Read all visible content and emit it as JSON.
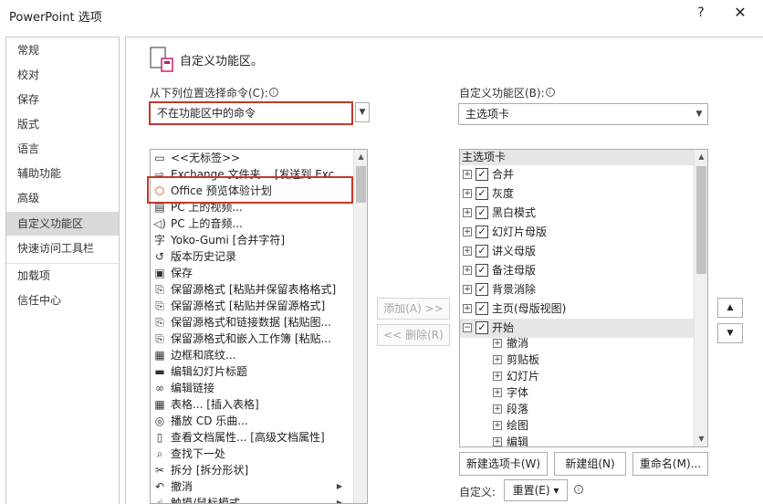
{
  "window": {
    "title": "PowerPoint 选项",
    "help_label": "?",
    "close_label": "✕"
  },
  "sidebar": {
    "items": [
      {
        "label": "常规"
      },
      {
        "label": "校对"
      },
      {
        "label": "保存"
      },
      {
        "label": "版式"
      },
      {
        "label": "语言"
      },
      {
        "label": "辅助功能"
      },
      {
        "label": "高级"
      },
      {
        "label": "自定义功能区",
        "active": true
      },
      {
        "label": "快速访问工具栏"
      },
      {
        "label": "加载项"
      },
      {
        "label": "信任中心"
      }
    ]
  },
  "section": {
    "title": "自定义功能区。"
  },
  "left": {
    "choose_label": "从下列位置选择命令(C):",
    "info": "i",
    "choose_value": "不在功能区中的命令",
    "arrow": "▼",
    "commands": [
      {
        "icon": "tag-icon",
        "glyph": "▭",
        "label": "<<无标签>>"
      },
      {
        "icon": "exchange-folder-icon",
        "glyph": "⇨",
        "label": "Exchange 文件夹... [发送到 Exc"
      },
      {
        "icon": "office-logo-icon",
        "glyph": "⬡",
        "label": "Office 预览体验计划"
      },
      {
        "icon": "video-icon",
        "glyph": "▤",
        "label": "PC 上的视频..."
      },
      {
        "icon": "audio-icon",
        "glyph": "◁)",
        "label": "PC 上的音频..."
      },
      {
        "icon": "yoko-gumi-icon",
        "glyph": "字",
        "label": "Yoko-Gumi [合并字符]"
      },
      {
        "icon": "history-icon",
        "glyph": "↺",
        "label": "版本历史记录"
      },
      {
        "icon": "save-icon",
        "glyph": "▣",
        "label": "保存"
      },
      {
        "icon": "paste-keep-source-icon",
        "glyph": "⎘",
        "label": "保留源格式 [粘贴并保留表格格式]"
      },
      {
        "icon": "paste-keep-source-icon",
        "glyph": "⎘",
        "label": "保留源格式 [粘贴并保留源格式]"
      },
      {
        "icon": "paste-link-icon",
        "glyph": "⎘",
        "label": "保留源格式和链接数据 [粘贴图..."
      },
      {
        "icon": "paste-embed-icon",
        "glyph": "⎘",
        "label": "保留源格式和嵌入工作簿 [粘贴..."
      },
      {
        "icon": "border-shading-icon",
        "glyph": "▦",
        "label": "边框和底纹..."
      },
      {
        "icon": "edit-slide-title-icon",
        "glyph": "▬",
        "label": "编辑幻灯片标题"
      },
      {
        "icon": "edit-link-icon",
        "glyph": "∞",
        "label": "编辑链接"
      },
      {
        "icon": "table-icon",
        "glyph": "▦",
        "label": "表格... [插入表格]"
      },
      {
        "icon": "cd-icon",
        "glyph": "◎",
        "label": "播放 CD 乐曲..."
      },
      {
        "icon": "doc-properties-icon",
        "glyph": "▯",
        "label": "查看文档属性... [高级文档属性]"
      },
      {
        "icon": "find-next-icon",
        "glyph": "⌕",
        "label": "查找下一处"
      },
      {
        "icon": "split-icon",
        "glyph": "✂",
        "label": "拆分 [拆分形状]"
      },
      {
        "icon": "undo-icon",
        "glyph": "↶",
        "label": "撤消",
        "submenu": true
      },
      {
        "icon": "touch-mouse-icon",
        "glyph": "☝",
        "label": "触摸/鼠标模式",
        "submenu": true
      }
    ]
  },
  "middle": {
    "add_label": "添加(A) >>",
    "remove_label": "<< 删除(R)"
  },
  "right": {
    "customize_label": "自定义功能区(B):",
    "info": "i",
    "customize_value": "主选项卡",
    "arrow": "▼",
    "tree_header": "主选项卡",
    "tree": [
      {
        "label": "合并",
        "expander": "+",
        "checked": "✓"
      },
      {
        "label": "灰度",
        "expander": "+",
        "checked": "✓"
      },
      {
        "label": "黑白模式",
        "expander": "+",
        "checked": "✓"
      },
      {
        "label": "幻灯片母版",
        "expander": "+",
        "checked": "✓"
      },
      {
        "label": "讲义母版",
        "expander": "+",
        "checked": "✓"
      },
      {
        "label": "备注母版",
        "expander": "+",
        "checked": "✓"
      },
      {
        "label": "背景消除",
        "expander": "+",
        "checked": "✓"
      },
      {
        "label": "主页(母版视图)",
        "expander": "+",
        "checked": "✓"
      },
      {
        "label": "开始",
        "expander": "−",
        "checked": "✓",
        "selected": true
      }
    ],
    "groups": [
      {
        "label": "撤消",
        "expander": "+"
      },
      {
        "label": "剪贴板",
        "expander": "+"
      },
      {
        "label": "幻灯片",
        "expander": "+"
      },
      {
        "label": "字体",
        "expander": "+"
      },
      {
        "label": "段落",
        "expander": "+"
      },
      {
        "label": "绘图",
        "expander": "+"
      },
      {
        "label": "编辑",
        "expander": "+"
      }
    ],
    "move_up": "▲",
    "move_down": "▼",
    "new_tab_label": "新建选项卡(W)",
    "new_group_label": "新建组(N)",
    "rename_label": "重命名(M)...",
    "customizations_label": "自定义:",
    "reset_label": "重置(E) ▾",
    "info2": "i"
  },
  "scroll": {
    "up": "▲",
    "down": "▼"
  }
}
